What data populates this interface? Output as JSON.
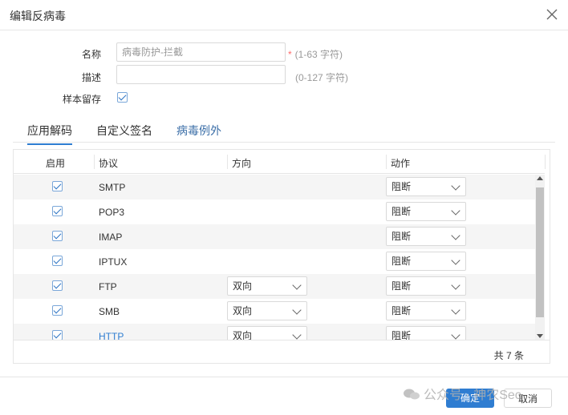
{
  "dialog": {
    "title": "编辑反病毒"
  },
  "form": {
    "name_label": "名称",
    "name_value": "病毒防护-拦截",
    "name_required": "*",
    "name_hint": "(1-63 字符)",
    "desc_label": "描述",
    "desc_value": "",
    "desc_hint": "(0-127 字符)",
    "sample_label": "样本留存",
    "sample_checked": true
  },
  "tabs": [
    {
      "label": "应用解码",
      "active": true
    },
    {
      "label": "自定义签名",
      "active": false
    },
    {
      "label": "病毒例外",
      "active": false
    }
  ],
  "table": {
    "headers": {
      "enable": "启用",
      "protocol": "协议",
      "direction": "方向",
      "action": "动作"
    },
    "rows": [
      {
        "enabled": true,
        "protocol": "SMTP",
        "direction": "",
        "action": "阻断"
      },
      {
        "enabled": true,
        "protocol": "POP3",
        "direction": "",
        "action": "阻断"
      },
      {
        "enabled": true,
        "protocol": "IMAP",
        "direction": "",
        "action": "阻断"
      },
      {
        "enabled": true,
        "protocol": "IPTUX",
        "direction": "",
        "action": "阻断"
      },
      {
        "enabled": true,
        "protocol": "FTP",
        "direction": "双向",
        "action": "阻断"
      },
      {
        "enabled": true,
        "protocol": "SMB",
        "direction": "双向",
        "action": "阻断"
      },
      {
        "enabled": true,
        "protocol": "HTTP",
        "direction": "双向",
        "action": "阻断"
      }
    ],
    "total": "共 7 条"
  },
  "footer": {
    "ok_label": "确定",
    "cancel_label": "取消"
  },
  "watermark": {
    "text": "公众号 · 神农Sec",
    "icon": "wechat-icon"
  },
  "colors": {
    "accent": "#2f7dd1",
    "link": "#2f7dd1",
    "required": "#ff6a6a"
  }
}
